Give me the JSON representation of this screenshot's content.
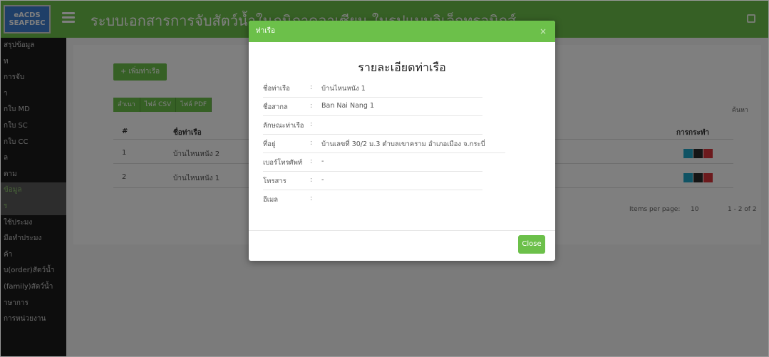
{
  "app": {
    "logo_line1": "eACDS",
    "logo_line2": "SEAFDEC",
    "title": "ระบบเอกสารการจับสัตว์น้ำในภูมิภาคอาเซียน ในรูปแบบอิเล็กทรอนิกส์"
  },
  "sidebar": {
    "items": [
      {
        "label": "สรุปข้อมูล"
      },
      {
        "label": "ท"
      },
      {
        "label": "การจับ"
      },
      {
        "label": "า"
      },
      {
        "label": "กใบ MD"
      },
      {
        "label": "กใบ SC"
      },
      {
        "label": "กใบ CC"
      },
      {
        "label": "ล"
      },
      {
        "label": "ตาม"
      },
      {
        "label": "ข้อมูล"
      },
      {
        "label": "ร"
      },
      {
        "label": "ใช้ประมง"
      },
      {
        "label": "มือทำประมง"
      },
      {
        "label": "ค้า"
      },
      {
        "label": "บ(order)สัตว์น้ำ"
      },
      {
        "label": "(family)สัตว์น้ำ"
      },
      {
        "label": "าษาการ"
      },
      {
        "label": "การหน่วยงาน"
      }
    ],
    "active_index": 9
  },
  "page": {
    "add_button": "+ เพิ่มท่าเรือ",
    "export_buttons": [
      "สำเนา",
      "ไฟล์ CSV",
      "ไฟล์ PDF"
    ],
    "search_label": "ค้นหา",
    "table": {
      "headers": [
        "#",
        "ชื่อท่าเรือ",
        "การกระทำ"
      ],
      "rows": [
        {
          "no": "1",
          "name": "บ้านไหนหนัง 2"
        },
        {
          "no": "2",
          "name": "บ้านไหนหนัง 1"
        }
      ]
    },
    "pager": {
      "items_label": "Items per page:",
      "per_page": "10",
      "range": "1 - 2 of 2"
    }
  },
  "modal": {
    "header": "ท่าเรือ",
    "close_x": "×",
    "title": "รายละเอียดท่าเรือ",
    "fields": [
      {
        "label": "ชื่อท่าเรือ",
        "value": "บ้านไหนหนัง 1"
      },
      {
        "label": "ชื่อสากล",
        "value": "Ban Nai Nang 1"
      },
      {
        "label": "ลักษณะท่าเรือ",
        "value": ""
      },
      {
        "label": "ที่อยู่",
        "value": "บ้านเลขที่ 30/2 ม.3 ตำบลเขาคราม อำเภอเมือง จ.กระบี่"
      },
      {
        "label": "เบอร์โทรศัพท์",
        "value": "-"
      },
      {
        "label": "โทรสาร",
        "value": "-"
      },
      {
        "label": "อีเมล",
        "value": ""
      }
    ],
    "close_button": "Close"
  },
  "colors": {
    "brand_green": "#6cc04a",
    "sidebar_bg": "#1a1a1a",
    "logo_blue": "#3f7fd0"
  }
}
